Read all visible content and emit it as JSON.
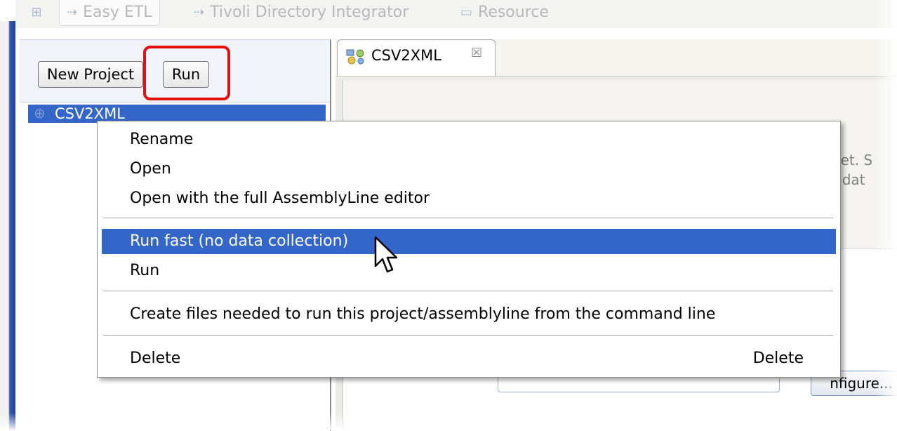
{
  "perspectives": {
    "easy_etl": "Easy ETL",
    "tdi": "Tivoli Directory Integrator",
    "resource": "Resource"
  },
  "navigator": {
    "new_project_label": "New Project",
    "run_label": "Run",
    "tree_item": "CSV2XML"
  },
  "editor": {
    "tab_title": "CSV2XML",
    "snippet_line1": "rget. S",
    "snippet_line2": "w dat",
    "configure_label": "nfigure..."
  },
  "context_menu": {
    "rename": "Rename",
    "open": "Open",
    "open_full": "Open with the full AssemblyLine editor",
    "run_fast": "Run fast (no data collection)",
    "run": "Run",
    "create_files": "Create files needed to run this project/assemblyline from the command line",
    "delete": "Delete",
    "delete_shortcut": "Delete"
  },
  "colors": {
    "selection": "#3465c8",
    "highlight_box": "#e41010"
  }
}
